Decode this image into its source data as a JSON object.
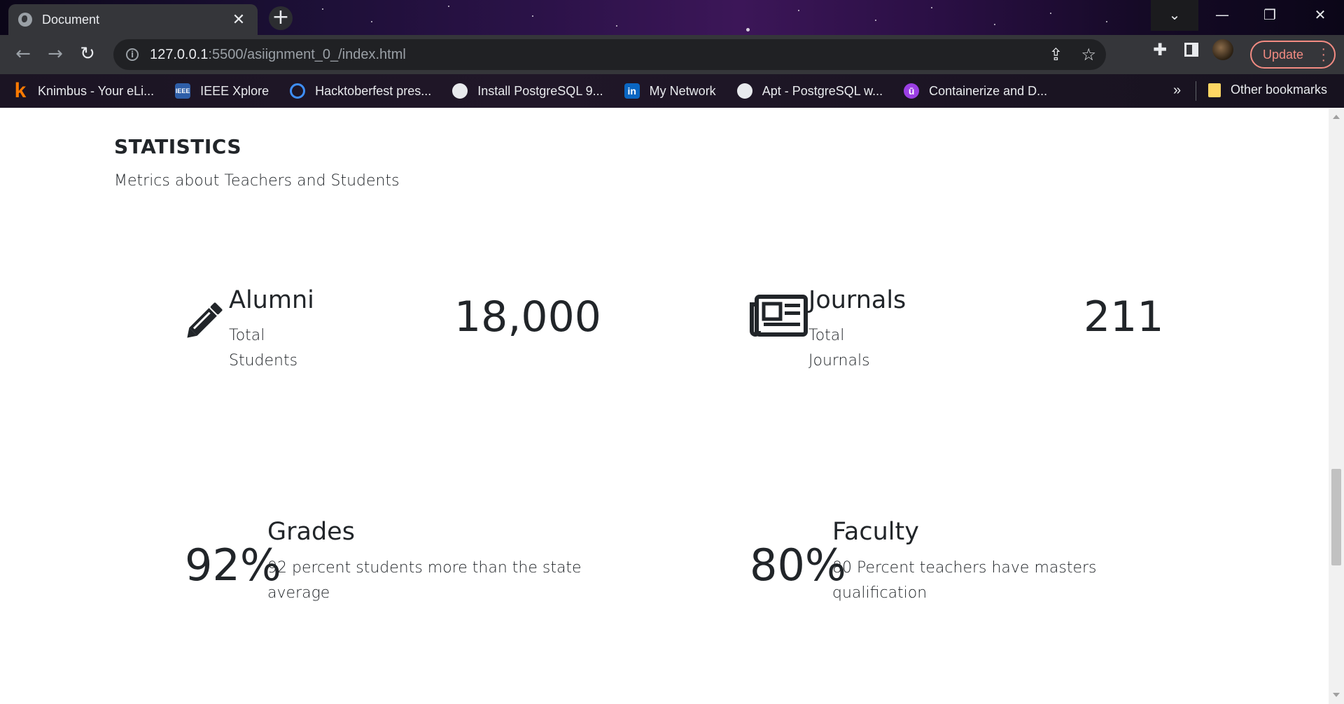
{
  "browser": {
    "tab_title": "Document",
    "url_host": "127.0.0.1",
    "url_rest": ":5500/asiignment_0_/index.html",
    "update_label": "Update",
    "bookmarks": [
      {
        "label": "Knimbus - Your eLi...",
        "icon": "knimbus-icon"
      },
      {
        "label": "IEEE Xplore",
        "icon": "ieee-icon"
      },
      {
        "label": "Hacktoberfest pres...",
        "icon": "hacktoberfest-icon"
      },
      {
        "label": "Install PostgreSQL 9...",
        "icon": "globe-icon"
      },
      {
        "label": "My Network",
        "icon": "linkedin-icon"
      },
      {
        "label": "Apt - PostgreSQL w...",
        "icon": "globe-icon"
      },
      {
        "label": "Containerize and D...",
        "icon": "udemy-icon"
      }
    ],
    "more_bookmarks": "»",
    "other_bookmarks": "Other bookmarks"
  },
  "statistics": {
    "title": "STATISTICS",
    "subtitle": "Metrics about Teachers and Students",
    "alumni": {
      "title": "Alumni",
      "desc": "Total Students",
      "value": "18,000",
      "icon": "pencil-icon"
    },
    "journals": {
      "title": "Journals",
      "desc": "Total Journals",
      "value": "211",
      "icon": "newspaper-icon"
    },
    "grades": {
      "title": "Grades",
      "desc": "92 percent students more than the state average",
      "value": "92%"
    },
    "faculty": {
      "title": "Faculty",
      "desc": "80 Percent teachers have masters qualification",
      "value": "80%"
    }
  }
}
